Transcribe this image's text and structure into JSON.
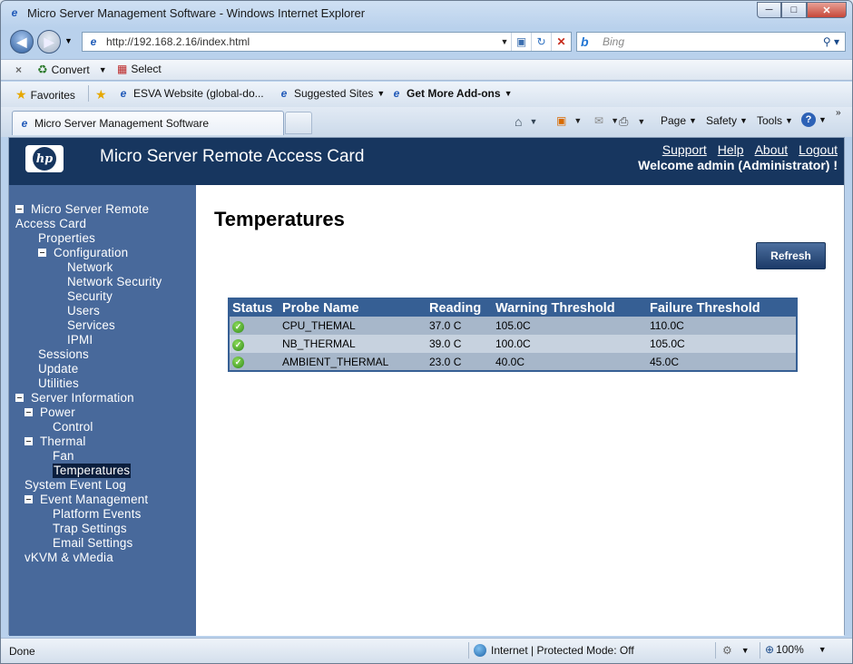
{
  "window": {
    "title": "Micro Server Management Software - Windows Internet Explorer"
  },
  "address": {
    "url": "http://192.168.2.16/index.html"
  },
  "search": {
    "placeholder": "Bing"
  },
  "cmdbar": {
    "convert": "Convert",
    "select": "Select"
  },
  "favorites": {
    "label": "Favorites",
    "items": [
      "ESVA Website (global-do...",
      "Suggested Sites",
      "Get More Add-ons"
    ]
  },
  "tab": {
    "label": "Micro Server Management Software"
  },
  "tools": {
    "page": "Page",
    "safety": "Safety",
    "tools": "Tools"
  },
  "header": {
    "logo": "hp",
    "title": "Micro Server Remote Access Card",
    "links": [
      "Support",
      "Help",
      "About",
      "Logout"
    ],
    "welcome": "Welcome admin (Administrator) !"
  },
  "nav": {
    "root_line1": "Micro Server Remote",
    "root_line2": "Access Card",
    "properties": "Properties",
    "configuration": "Configuration",
    "network": "Network",
    "network_security": "Network Security",
    "security": "Security",
    "users": "Users",
    "services": "Services",
    "ipmi": "IPMI",
    "sessions": "Sessions",
    "update": "Update",
    "utilities": "Utilities",
    "server_information": "Server Information",
    "power": "Power",
    "control": "Control",
    "thermal": "Thermal",
    "fan": "Fan",
    "temperatures": "Temperatures",
    "system_event_log": "System Event Log",
    "event_management": "Event Management",
    "platform_events": "Platform Events",
    "trap_settings": "Trap Settings",
    "email_settings": "Email Settings",
    "vkvm": "vKVM & vMedia"
  },
  "main": {
    "title": "Temperatures",
    "refresh": "Refresh",
    "columns": [
      "Status",
      "Probe Name",
      "Reading",
      "Warning Threshold",
      "Failure Threshold"
    ],
    "rows": [
      {
        "probe": "CPU_THEMAL",
        "reading": "37.0 C",
        "warning": "105.0C",
        "failure": "110.0C",
        "status": "ok"
      },
      {
        "probe": "NB_THERMAL",
        "reading": "39.0 C",
        "warning": "100.0C",
        "failure": "105.0C",
        "status": "ok"
      },
      {
        "probe": "AMBIENT_THERMAL",
        "reading": "23.0 C",
        "warning": "40.0C",
        "failure": "45.0C",
        "status": "ok"
      }
    ]
  },
  "status": {
    "left": "Done",
    "zone": "Internet | Protected Mode: Off",
    "zoom": "100%"
  }
}
